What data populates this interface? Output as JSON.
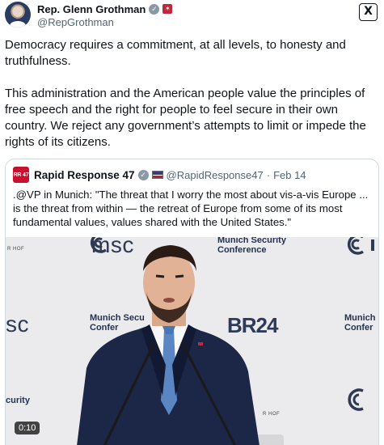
{
  "post": {
    "author_name": "Rep. Glenn Grothman",
    "author_handle": "@RepGrothman",
    "paragraphs": [
      "Democracy requires a commitment, at all levels, to honesty and truthfulness.",
      "This administration and the American people value the principles of free speech and the right for people to feel secure in their own country. We reject any government’s attempts to limit or impede the rights of its citizens."
    ]
  },
  "quote": {
    "author_name": "Rapid Response 47",
    "author_handle": "@RapidResponse47",
    "separator": "·",
    "date": "Feb 14",
    "avatar_text": "RR 47",
    "text": ".@VP in Munich: \"The threat that I worry the most about vis-a-vis Europe ... is the threat from within — the retreat of Europe from some of its most fundamental values, values shared with the United States.\"",
    "video": {
      "duration": "0:10",
      "backdrop": {
        "msc_logo": "msc",
        "msc_logo_left": "sc",
        "conference_line1": "Munich Security",
        "conference_line2": "Conference",
        "munich_sec": "Munich Secu",
        "confer": "Confer",
        "br24": "BR24",
        "munich_right": "Munich",
        "confer_right": "Confer",
        "curity": "curity",
        "r_hof": "R HOF"
      }
    }
  },
  "colors": {
    "text": "#0f1419",
    "muted": "#536471",
    "border": "#cfd9de",
    "verified": "#8b98a5",
    "brand_red": "#c8102e"
  },
  "icons": {
    "verified": "verified-badge-icon",
    "gov": "government-label-icon",
    "x": "x-logo-icon",
    "flag": "us-flag-icon"
  }
}
